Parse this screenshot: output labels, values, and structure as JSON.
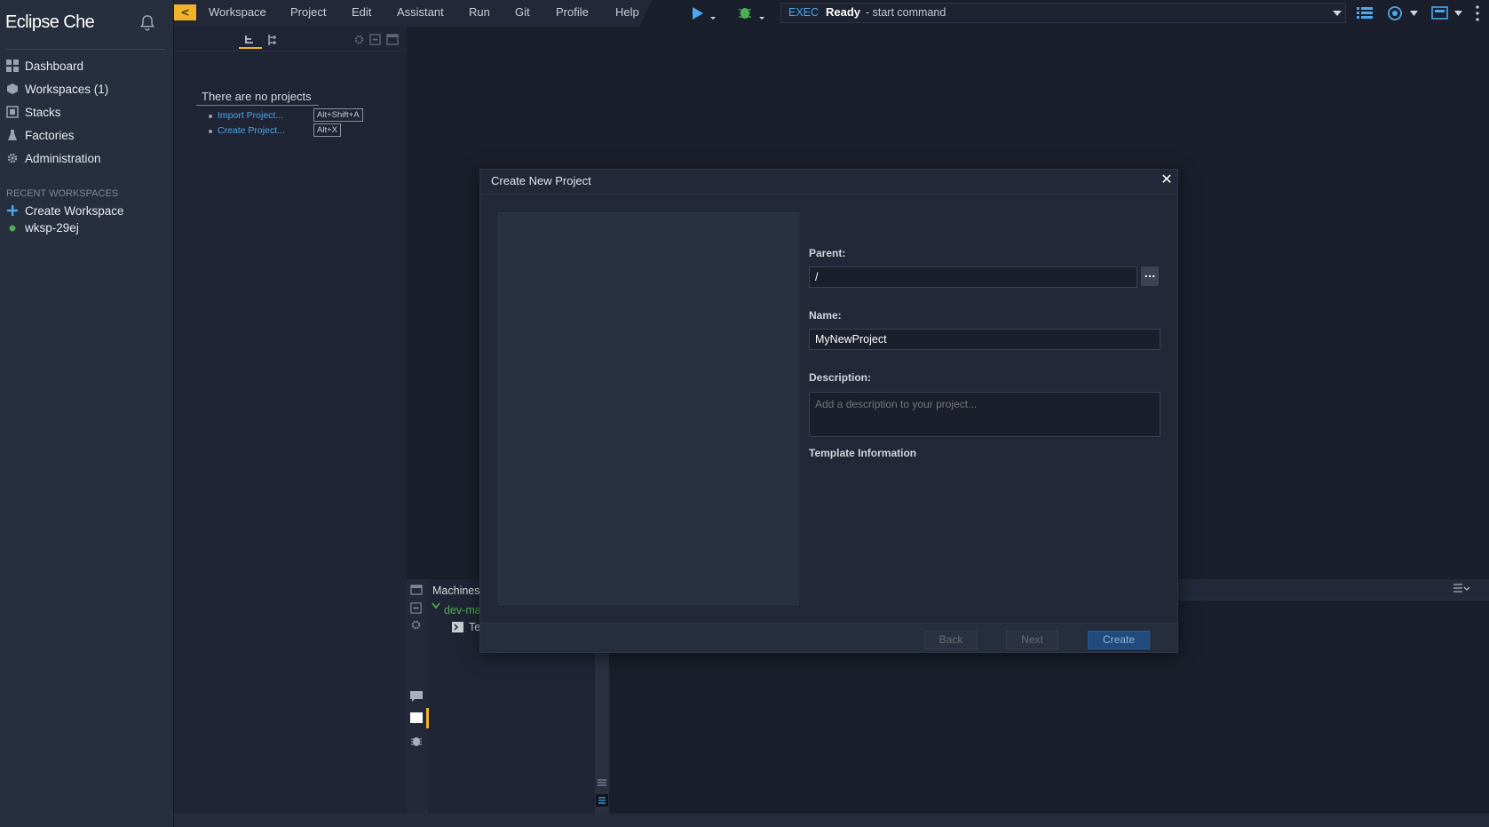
{
  "sidebar": {
    "brand": "Eclipse Che",
    "nav": [
      {
        "label": "Dashboard",
        "icon": "dashboard-icon"
      },
      {
        "label": "Workspaces (1)",
        "icon": "workspaces-icon"
      },
      {
        "label": "Stacks",
        "icon": "stacks-icon"
      },
      {
        "label": "Factories",
        "icon": "factories-icon"
      },
      {
        "label": "Administration",
        "icon": "gear-icon"
      }
    ],
    "recent_title": "RECENT WORKSPACES",
    "recent": [
      {
        "label": "Create Workspace",
        "icon": "plus-icon"
      },
      {
        "label": "wksp-29ej",
        "icon": "status-dot-icon"
      }
    ]
  },
  "menubar": {
    "collapse": "<",
    "items": [
      "Workspace",
      "Project",
      "Edit",
      "Assistant",
      "Run",
      "Git",
      "Profile",
      "Help"
    ],
    "exec": "EXEC",
    "ready": "Ready",
    "start_command": "- start command"
  },
  "explorer": {
    "empty_title": "There are no projects",
    "links": [
      {
        "label": "Import Project...",
        "shortcut": "Alt+Shift+A"
      },
      {
        "label": "Create Project...",
        "shortcut": "Alt+X"
      }
    ]
  },
  "machines": {
    "title": "Machines",
    "dev_machine": "dev-ma",
    "terminal": "Te"
  },
  "modal": {
    "title": "Create New Project",
    "close": "✕",
    "parent_label": "Parent:",
    "parent_value": "/",
    "browse": "...",
    "name_label": "Name:",
    "name_value": "MyNewProject",
    "description_label": "Description:",
    "description_placeholder": "Add a description to your project...",
    "template_info": "Template Information",
    "back": "Back",
    "next": "Next",
    "create": "Create"
  },
  "colors": {
    "accent_blue": "#4aa8f0",
    "highlight_yellow": "#f0b32b",
    "ok_green": "#4caf50"
  }
}
